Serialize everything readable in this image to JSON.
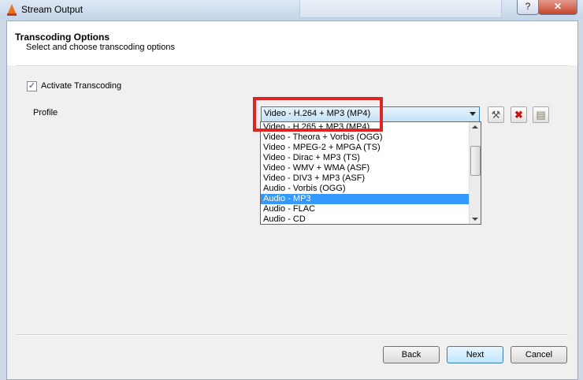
{
  "window": {
    "title": "Stream Output",
    "help_label": "?",
    "close_label": "✕"
  },
  "header": {
    "title": "Transcoding Options",
    "subtitle": "Select and choose transcoding options"
  },
  "activate": {
    "label": "Activate Transcoding",
    "checked": true,
    "check_glyph": "✓"
  },
  "profile": {
    "label": "Profile",
    "selected": "Video - H.264 + MP3 (MP4)",
    "options": [
      "Video - H.265 + MP3 (MP4)",
      "Video - Theora + Vorbis (OGG)",
      "Video - MPEG-2 + MPGA (TS)",
      "Video - Dirac + MP3 (TS)",
      "Video - WMV + WMA (ASF)",
      "Video - DIV3 + MP3 (ASF)",
      "Audio - Vorbis (OGG)",
      "Audio - MP3",
      "Audio - FLAC",
      "Audio - CD"
    ],
    "highlighted_option": "Audio - MP3",
    "tools": {
      "edit_glyph": "⚒",
      "delete_glyph": "✖",
      "new_glyph": "▤"
    }
  },
  "buttons": {
    "back": "Back",
    "next": "Next",
    "cancel": "Cancel"
  },
  "colors": {
    "selection": "#3399ff",
    "annotation": "#e02424"
  }
}
